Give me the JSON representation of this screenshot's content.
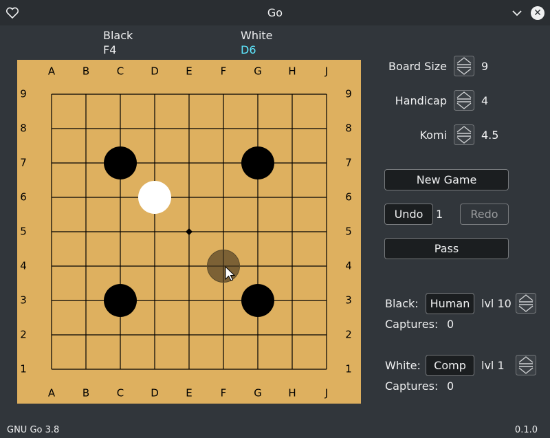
{
  "window": {
    "title": "Go",
    "heart_icon": "heart-icon",
    "minimize_icon": "chevron-down-icon",
    "close_icon": "close-icon"
  },
  "moves": {
    "black_label": "Black",
    "black_move": "F4",
    "white_label": "White",
    "white_move": "D6",
    "white_move_color": "#5ee8ff"
  },
  "board": {
    "columns": [
      "A",
      "B",
      "C",
      "D",
      "E",
      "F",
      "G",
      "H",
      "J"
    ],
    "rows": [
      "9",
      "8",
      "7",
      "6",
      "5",
      "4",
      "3",
      "2",
      "1"
    ],
    "color": "#deb05f",
    "stones": [
      {
        "col": "C",
        "row": "7",
        "color": "black"
      },
      {
        "col": "G",
        "row": "7",
        "color": "black"
      },
      {
        "col": "D",
        "row": "6",
        "color": "white"
      },
      {
        "col": "C",
        "row": "3",
        "color": "black"
      },
      {
        "col": "G",
        "row": "3",
        "color": "black"
      }
    ],
    "hover_stone": {
      "col": "F",
      "row": "4"
    },
    "star_point": {
      "col": "E",
      "row": "5"
    }
  },
  "settings": {
    "board_size_label": "Board Size",
    "board_size": "9",
    "handicap_label": "Handicap",
    "handicap": "4",
    "komi_label": "Komi",
    "komi": "4.5"
  },
  "actions": {
    "new_game": "New Game",
    "undo": "Undo",
    "undo_count": "1",
    "redo": "Redo",
    "pass": "Pass"
  },
  "players": {
    "black_label": "Black:",
    "black_type": "Human",
    "black_level": "lvl 10",
    "black_captures_label": "Captures:",
    "black_captures": "0",
    "white_label": "White:",
    "white_type": "Comp",
    "white_level": "lvl 1",
    "white_captures_label": "Captures:",
    "white_captures": "0"
  },
  "footer": {
    "engine": "GNU Go 3.8",
    "version": "0.1.0"
  }
}
